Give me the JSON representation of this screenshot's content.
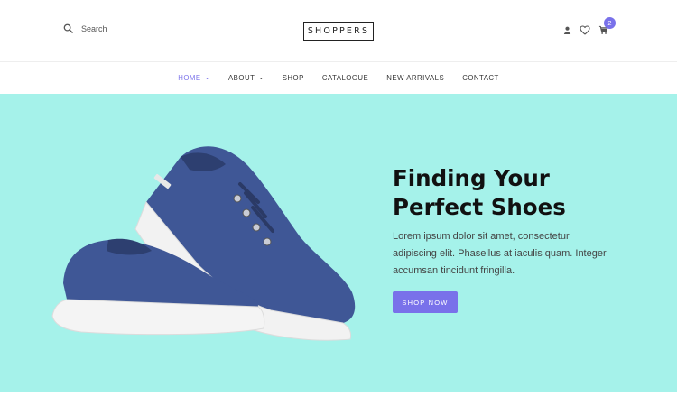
{
  "header": {
    "search_placeholder": "Search",
    "logo": "SHOPPERS",
    "cart_count": "2"
  },
  "nav": {
    "items": [
      {
        "label": "HOME",
        "dropdown": true,
        "active": true
      },
      {
        "label": "ABOUT",
        "dropdown": true,
        "active": false
      },
      {
        "label": "SHOP",
        "dropdown": false,
        "active": false
      },
      {
        "label": "CATALOGUE",
        "dropdown": false,
        "active": false
      },
      {
        "label": "NEW ARRIVALS",
        "dropdown": false,
        "active": false
      },
      {
        "label": "CONTACT",
        "dropdown": false,
        "active": false
      }
    ]
  },
  "hero": {
    "title_line1": "Finding Your",
    "title_line2": "Perfect Shoes",
    "text": "Lorem ipsum dolor sit amet, consectetur adipiscing elit. Phasellus at iaculis quam. Integer accumsan tincidunt fringilla.",
    "button_label": "SHOP NOW"
  },
  "icons": [
    "search-icon",
    "user-icon",
    "heart-icon",
    "cart-icon",
    "chevron-down-icon"
  ],
  "colors": {
    "accent": "#7971ea",
    "hero_bg": "#a5f2ea",
    "shoe": "#3f5796",
    "text_dark": "#111111"
  }
}
